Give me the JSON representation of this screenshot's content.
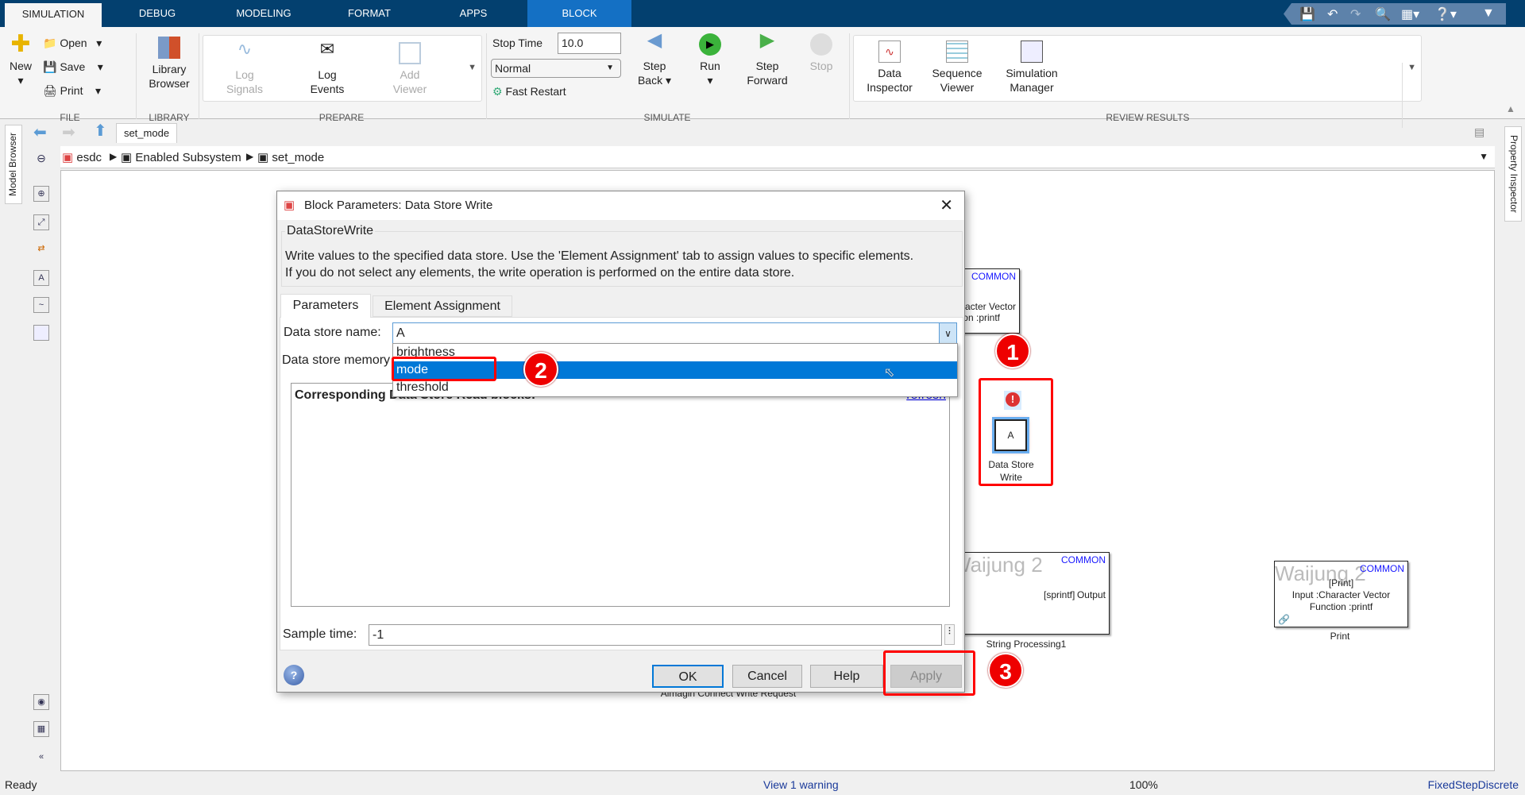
{
  "tabs": [
    "SIMULATION",
    "DEBUG",
    "MODELING",
    "FORMAT",
    "APPS",
    "BLOCK"
  ],
  "colors": {
    "tabbar": "#03406f",
    "block_tab": "#1470c4",
    "selection": "#0078d7",
    "annotation": "#ff0000"
  },
  "ribbon": {
    "file": {
      "new": "New",
      "open": "Open",
      "save": "Save",
      "print": "Print",
      "label": "FILE"
    },
    "library": {
      "line1": "Library",
      "line2": "Browser",
      "label": "LIBRARY"
    },
    "prepare": {
      "log_signals": [
        "Log",
        "Signals"
      ],
      "log_events": [
        "Log",
        "Events"
      ],
      "add_viewer": [
        "Add",
        "Viewer"
      ],
      "label": "PREPARE"
    },
    "simulate": {
      "stop_time_label": "Stop Time",
      "stop_time": "10.0",
      "mode": "Normal",
      "fast_restart": "Fast Restart",
      "step_back": [
        "Step",
        "Back"
      ],
      "run": "Run",
      "step_forward": [
        "Step",
        "Forward"
      ],
      "stop": "Stop",
      "label": "SIMULATE"
    },
    "review": {
      "data_inspector": [
        "Data",
        "Inspector"
      ],
      "sequence_viewer": [
        "Sequence",
        "Viewer"
      ],
      "sim_manager": [
        "Simulation",
        "Manager"
      ],
      "label": "REVIEW RESULTS"
    }
  },
  "nav": {
    "tab": "set_mode"
  },
  "breadcrumb": [
    "esdc",
    "Enabled Subsystem",
    "set_mode"
  ],
  "side": {
    "model_browser": "Model Browser",
    "property_inspector": "Property Inspector"
  },
  "canvas": {
    "block_top": {
      "common": "COMMON",
      "line1": "Input :Character Vector",
      "line2": "Function :printf"
    },
    "dsw": {
      "glyph": "A",
      "label1": "Data Store",
      "label2": "Write"
    },
    "string_proc": {
      "brand": "Waijung 2",
      "common": "COMMON",
      "func": "[sprintf]",
      "port": "Output",
      "label": "String Processing1"
    },
    "print": {
      "brand": "Waijung 2",
      "common": "COMMON",
      "func": "[Print]",
      "line1": "Input :Character Vector",
      "line2": "Function :printf",
      "label": "Print"
    },
    "hidden_label": "Aimagin Connect Write Request"
  },
  "dialog": {
    "title": "Block Parameters: Data Store Write",
    "group": "DataStoreWrite",
    "desc1": "Write values to the specified data store. Use the 'Element Assignment' tab to assign values to specific elements.",
    "desc2": "If you do not select any elements, the write operation is performed on the entire data store.",
    "tabs": [
      "Parameters",
      "Element Assignment"
    ],
    "ds_name_label": "Data store name:",
    "ds_name_value": "A",
    "options": [
      "brightness",
      "mode",
      "threshold"
    ],
    "ds_mem_label": "Data store memory block:",
    "corr_header": "Corresponding Data Store Read blocks:",
    "refresh": "refresh",
    "sample_label": "Sample time:",
    "sample_value": "-1",
    "buttons": {
      "ok": "OK",
      "cancel": "Cancel",
      "help": "Help",
      "apply": "Apply"
    }
  },
  "annotations": [
    "1",
    "2",
    "3"
  ],
  "status": {
    "left": "Ready",
    "warning": "View 1 warning",
    "zoom": "100%",
    "solver": "FixedStepDiscrete"
  }
}
